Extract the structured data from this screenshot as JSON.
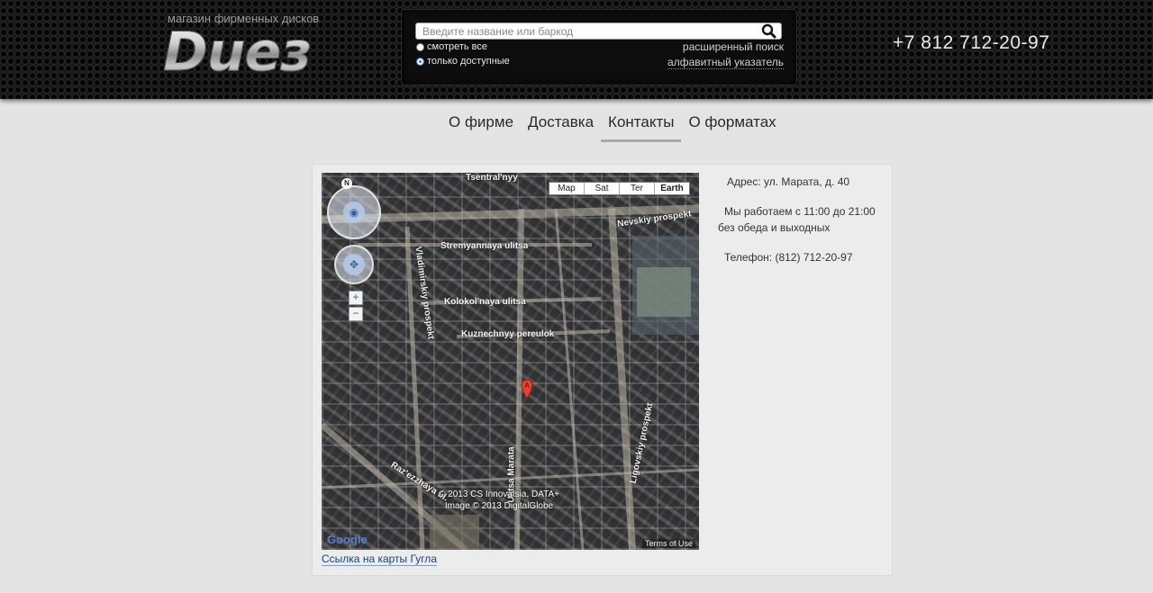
{
  "header": {
    "tagline": "магазин фирменных дисков",
    "logo_text": "Duез",
    "search": {
      "placeholder": "Введите название или баркод",
      "value": ""
    },
    "radio_all": "смотреть все",
    "radio_available": "только доступные",
    "selected_radio": "только доступные",
    "advanced_search": "расширенный поиск",
    "alphabet_index": "алфавитный указатель",
    "phone": "+7 812 712-20-97",
    "search_icon": "search-icon"
  },
  "nav": {
    "items": [
      "О фирме",
      "Доставка",
      "Контакты",
      "О форматах"
    ],
    "active": "Контакты"
  },
  "contacts": {
    "address": "Адрес: ул. Марата, д. 40",
    "hours_line1": "Мы работаем с 11:00 до 21:00",
    "hours_line2": "без обеда и выходных",
    "phone": "Телефон: (812) 712-20-97",
    "map_link": "Ссылка на карты Гугла"
  },
  "map": {
    "types": [
      "Map",
      "Sat",
      "Ter",
      "Earth"
    ],
    "active_type": "Earth",
    "compass": "N",
    "labels": {
      "tsentralny": "Tsentral'nyy",
      "nevskiy": "Nevskiy prospekt",
      "stremyannaya": "Stremyannaya ulitsa",
      "kolokolnaya": "Kolokol'naya ulitsa",
      "kuznechnyy": "Kuznechnyy pereulok",
      "ligovskiy": "Ligovskiy prospekt",
      "marata": "Ulitsa Marata",
      "razezzhaya": "Raz'ezzhaya ul.",
      "vladimirskiy": "Vladimirskiy prospekt"
    },
    "copyright_line1": "© 2013 CS Innovatsia, DATA+",
    "copyright_line2": "Image © 2013 DigitalGlobe",
    "google": "Google",
    "terms": "Terms of Use",
    "pin_label": "A"
  },
  "colors": {
    "page_bg": "#e4e4e4",
    "header_bg": "#161616",
    "link": "#233f7a",
    "nav_active_underline": "#a9a9a9"
  }
}
